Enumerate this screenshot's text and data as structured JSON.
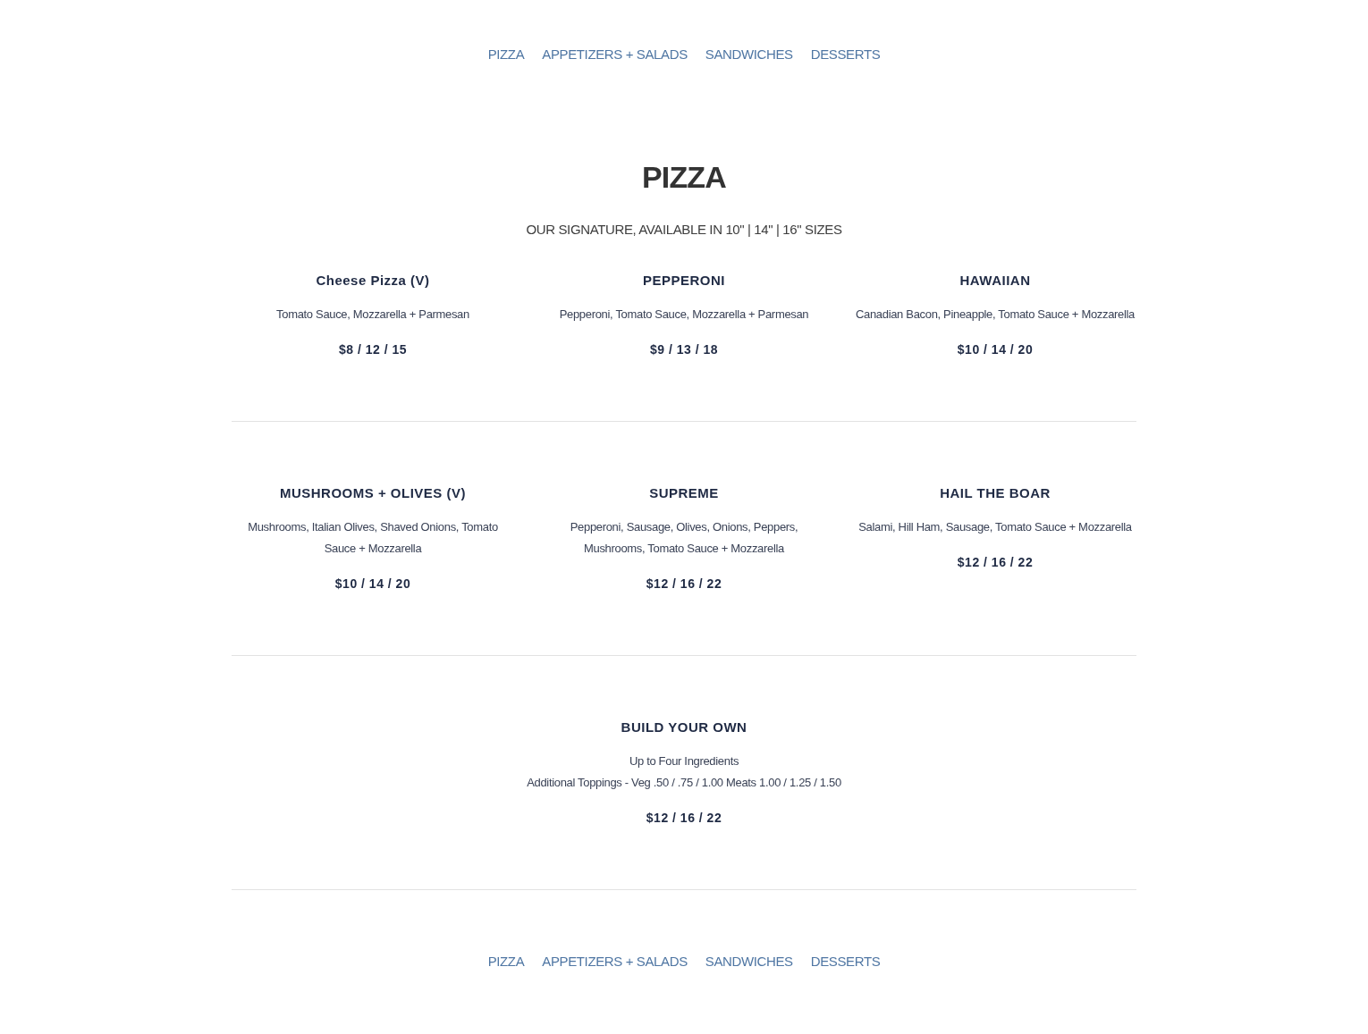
{
  "nav_top": [
    "PIZZA",
    "APPETIZERS + SALADS",
    "SANDWICHES",
    "DESSERTS"
  ],
  "section": {
    "title": "PIZZA",
    "subtitle": "OUR SIGNATURE, AVAILABLE IN 10\" | 14\" | 16\" SIZES",
    "rows": [
      {
        "items": [
          {
            "name": "Cheese Pizza (V)",
            "description": [
              "Tomato Sauce, Mozzarella + Parmesan"
            ],
            "price": "$8 / 12 / 15"
          },
          {
            "name": "PEPPERONI",
            "description": [
              "Pepperoni, Tomato Sauce, Mozzarella + Parmesan"
            ],
            "price": "$9 / 13 / 18"
          },
          {
            "name": "HAWAIIAN",
            "description": [
              "Canadian Bacon, Pineapple, Tomato Sauce + Mozzarella"
            ],
            "price": "$10 / 14 / 20"
          }
        ]
      },
      {
        "items": [
          {
            "name": "MUSHROOMS + OLIVES (V)",
            "description": [
              "Mushrooms, Italian Olives, Shaved Onions, Tomato Sauce + Mozzarella"
            ],
            "price": "$10 / 14 / 20"
          },
          {
            "name": "SUPREME",
            "description": [
              "Pepperoni, Sausage, Olives, Onions, Peppers, Mushrooms, Tomato Sauce + Mozzarella"
            ],
            "price": "$12 / 16 / 22"
          },
          {
            "name": "HAIL THE BOAR",
            "description": [
              "Salami, Hill Ham, Sausage, Tomato Sauce + Mozzarella"
            ],
            "price": "$12 / 16 / 22"
          }
        ]
      },
      {
        "items": [
          {
            "name": "BUILD YOUR OWN",
            "description": [
              "Up to Four Ingredients",
              "Additional Toppings - Veg .50 / .75 / 1.00 Meats 1.00 / 1.25 / 1.50"
            ],
            "price": "$12 / 16 / 22"
          }
        ]
      }
    ]
  },
  "nav_bottom": [
    "PIZZA",
    "APPETIZERS + SALADS",
    "SANDWICHES",
    "DESSERTS"
  ]
}
